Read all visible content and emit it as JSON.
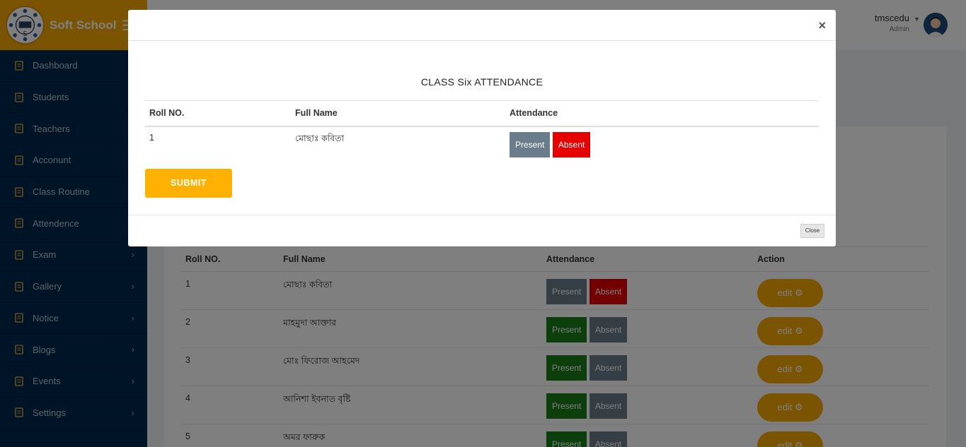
{
  "brand": {
    "name": "Soft School"
  },
  "user": {
    "name": "tmscedu",
    "role": "Admin"
  },
  "sidebar": {
    "items": [
      {
        "label": "Dashboard",
        "icon": "dashboard-icon",
        "has_submenu": false
      },
      {
        "label": "Students",
        "icon": "students-icon",
        "has_submenu": false
      },
      {
        "label": "Teachers",
        "icon": "teachers-icon",
        "has_submenu": false
      },
      {
        "label": "Acconunt",
        "icon": "account-icon",
        "has_submenu": false
      },
      {
        "label": "Class Routine",
        "icon": "calendar-icon",
        "has_submenu": false
      },
      {
        "label": "Attendence",
        "icon": "list-icon",
        "has_submenu": false
      },
      {
        "label": "Exam",
        "icon": "exam-icon",
        "has_submenu": true
      },
      {
        "label": "Gallery",
        "icon": "document-icon",
        "has_submenu": true
      },
      {
        "label": "Notice",
        "icon": "document-icon",
        "has_submenu": true
      },
      {
        "label": "Blogs",
        "icon": "document-icon",
        "has_submenu": true
      },
      {
        "label": "Events",
        "icon": "document-icon",
        "has_submenu": true
      },
      {
        "label": "Settings",
        "icon": "document-icon",
        "has_submenu": true
      }
    ]
  },
  "background_table": {
    "headers": [
      "Roll NO.",
      "Full Name",
      "Attendance",
      "Action"
    ],
    "rows": [
      {
        "roll": "1",
        "name": "মোছাঃ কবিতা",
        "present": "Present",
        "absent": "Absent",
        "status": "absent",
        "edit": "edit"
      },
      {
        "roll": "2",
        "name": "মাহমুদা আক্তার",
        "present": "Present",
        "absent": "Absent",
        "status": "present",
        "edit": "edit"
      },
      {
        "roll": "3",
        "name": "মোঃ ফিরোজ আহমেদ",
        "present": "Present",
        "absent": "Absent",
        "status": "present",
        "edit": "edit"
      },
      {
        "roll": "4",
        "name": "আনিশা ইবনাত বৃষ্টি",
        "present": "Present",
        "absent": "Absent",
        "status": "present",
        "edit": "edit"
      },
      {
        "roll": "5",
        "name": "অমর ফারুক",
        "present": "Present",
        "absent": "Absent",
        "status": "present",
        "edit": "edit"
      }
    ]
  },
  "modal": {
    "close_symbol": "×",
    "title": "CLASS Six ATTENDANCE",
    "headers": [
      "Roll NO.",
      "Full Name",
      "Attendance"
    ],
    "row": {
      "roll": "1",
      "name": "মোছাঃ কবিতা",
      "present": "Present",
      "absent": "Absent",
      "status": "absent"
    },
    "submit_label": "SUBMIT",
    "close_label": "Close"
  },
  "colors": {
    "brand": "#f5a800",
    "sidebar": "#01284e",
    "present_active": "#1a7f1a",
    "inactive": "#6b7d8a",
    "absent_active": "#e60000",
    "submit": "#ffb100"
  }
}
